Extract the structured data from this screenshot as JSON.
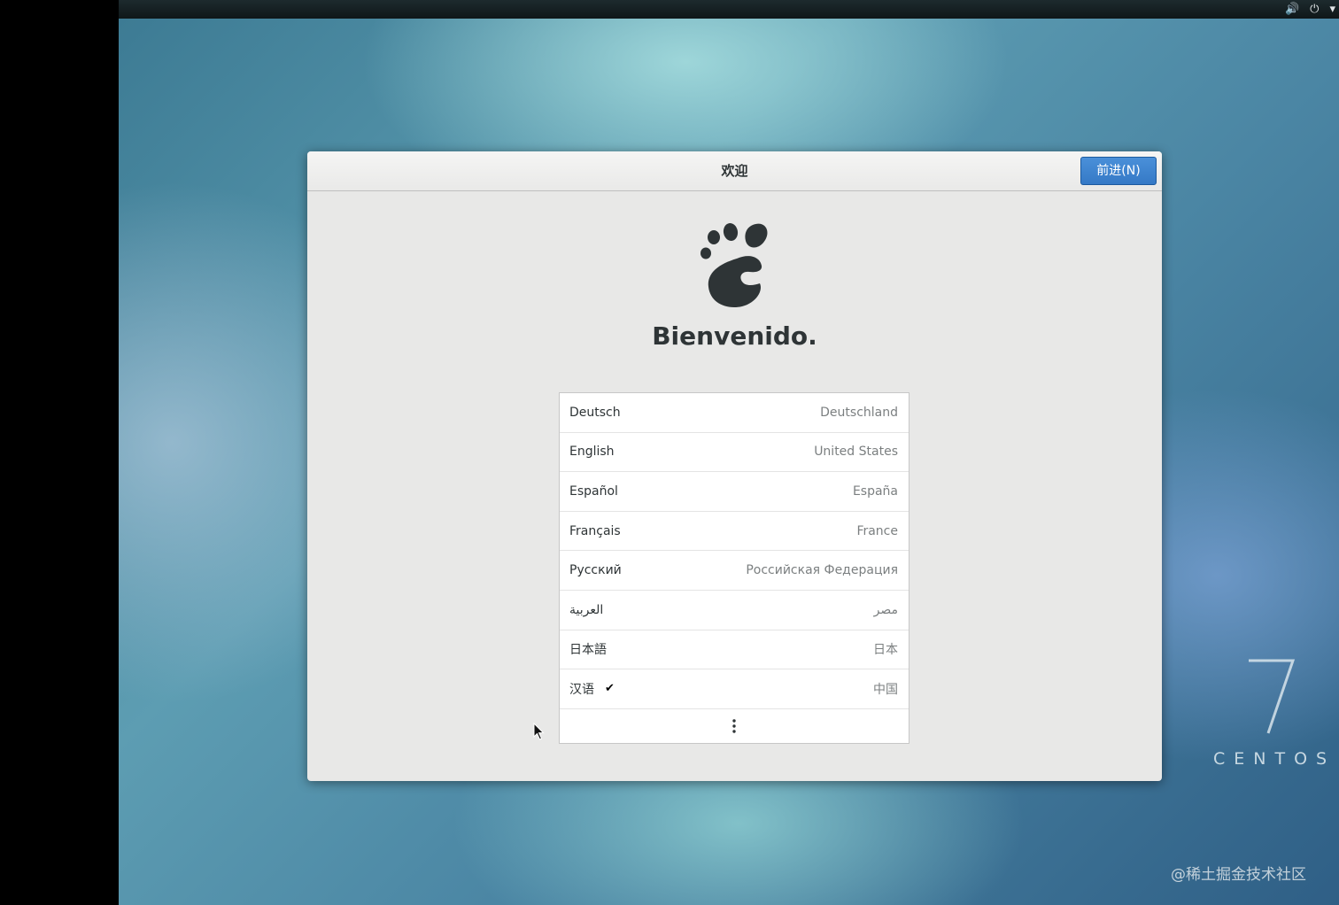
{
  "topbar": {
    "icons": [
      "volume-icon",
      "power-icon",
      "chevron-down-icon"
    ],
    "volume_glyph": "🔊",
    "power_glyph": "⏻",
    "menu_glyph": "▾"
  },
  "dialog": {
    "title": "欢迎",
    "next_button": "前进(N)",
    "welcome": "Bienvenido.",
    "logo": "gnome-foot-icon"
  },
  "languages": [
    {
      "name": "Deutsch",
      "region": "Deutschland",
      "selected": false
    },
    {
      "name": "English",
      "region": "United States",
      "selected": false
    },
    {
      "name": "Español",
      "region": "España",
      "selected": false
    },
    {
      "name": "Français",
      "region": "France",
      "selected": false
    },
    {
      "name": "Русский",
      "region": "Российская Федерация",
      "selected": false
    },
    {
      "name": "العربية",
      "region": "مصر",
      "selected": false
    },
    {
      "name": "日本語",
      "region": "日本",
      "selected": false
    },
    {
      "name": "汉语",
      "region": "中国",
      "selected": true
    }
  ],
  "check_glyph": "✔",
  "branding": {
    "version": "7",
    "name": "CENTOS"
  },
  "watermark": "@稀土掘金技术社区",
  "colors": {
    "accent": "#3a80d0",
    "dialog_bg": "#e8e8e7"
  }
}
